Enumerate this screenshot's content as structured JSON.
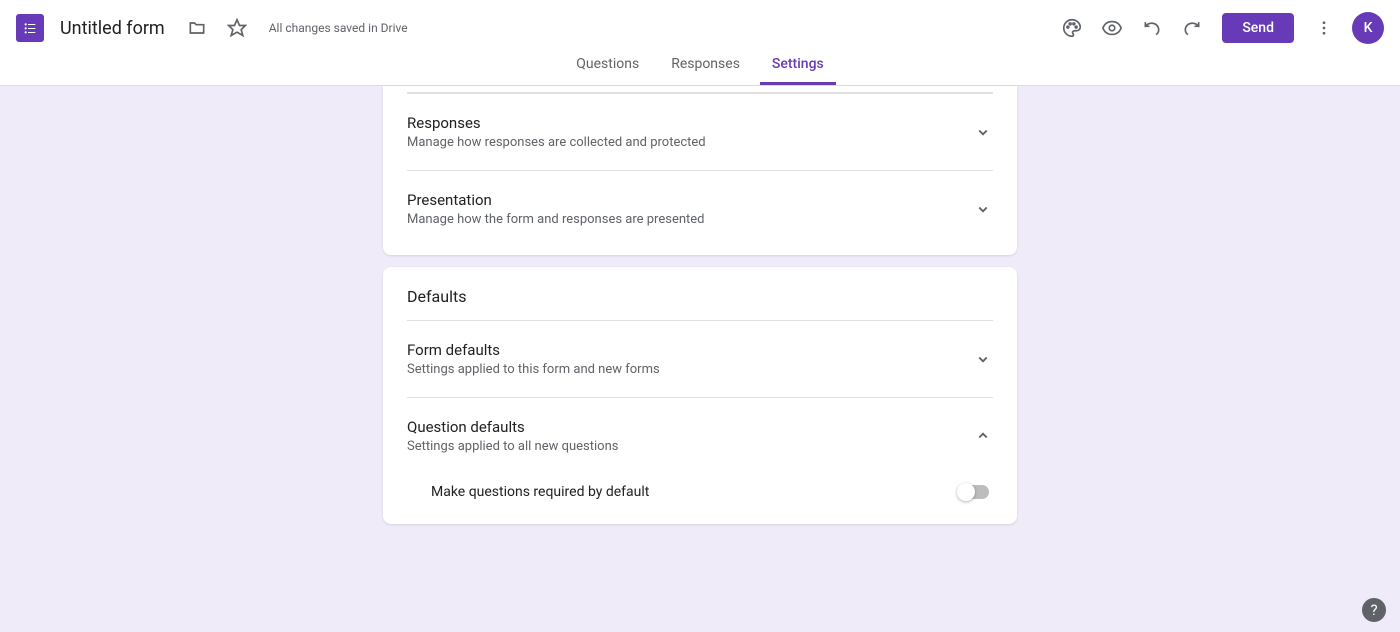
{
  "header": {
    "title": "Untitled form",
    "save_status": "All changes saved in Drive",
    "send_label": "Send",
    "avatar_initial": "K"
  },
  "tabs": {
    "questions": "Questions",
    "responses": "Responses",
    "settings": "Settings"
  },
  "card1": {
    "sections": {
      "responses": {
        "title": "Responses",
        "desc": "Manage how responses are collected and protected"
      },
      "presentation": {
        "title": "Presentation",
        "desc": "Manage how the form and responses are presented"
      }
    }
  },
  "card2": {
    "header": "Defaults",
    "sections": {
      "form_defaults": {
        "title": "Form defaults",
        "desc": "Settings applied to this form and new forms"
      },
      "question_defaults": {
        "title": "Question defaults",
        "desc": "Settings applied to all new questions"
      }
    },
    "toggle_label": "Make questions required by default"
  },
  "help": "?"
}
